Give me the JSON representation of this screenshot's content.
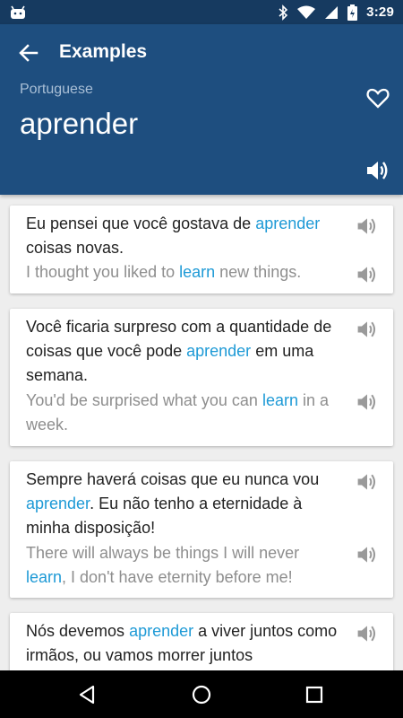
{
  "status_bar": {
    "time": "3:29",
    "icons": [
      "android-icon",
      "bluetooth-icon",
      "wifi-icon",
      "signal-icon",
      "battery-icon"
    ]
  },
  "header": {
    "title": "Examples",
    "language": "Portuguese",
    "word": "aprender",
    "icons": [
      "back-arrow-icon",
      "heart-icon",
      "speaker-icon"
    ]
  },
  "colors": {
    "header_bg": "#1e4e7f",
    "status_bg": "#163a60",
    "highlight": "#1e9ad6",
    "translation": "#8e8e8e"
  },
  "examples": [
    {
      "pt": [
        "Eu pensei que você gostava de ",
        "aprender",
        " coisas novas."
      ],
      "en": [
        "I thought you liked to ",
        "learn",
        " new things."
      ]
    },
    {
      "pt": [
        "Você ficaria surpreso com a quantidade de coisas que você pode ",
        "aprender",
        " em uma semana."
      ],
      "en": [
        "You'd be surprised what you can ",
        "learn",
        " in a week."
      ]
    },
    {
      "pt": [
        "Sempre haverá coisas que eu nunca vou ",
        "aprender",
        ". Eu não tenho a eternidade à minha disposição!"
      ],
      "en": [
        "There will always be things I will never ",
        "learn",
        ", I don't have eternity before me!"
      ]
    },
    {
      "pt": [
        "Nós devemos ",
        "aprender",
        " a viver juntos como irmãos, ou vamos morrer juntos"
      ],
      "en": [
        "",
        "",
        ""
      ]
    }
  ],
  "nav_bar": {
    "icons": [
      "back-triangle-icon",
      "home-circle-icon",
      "recents-square-icon"
    ]
  }
}
